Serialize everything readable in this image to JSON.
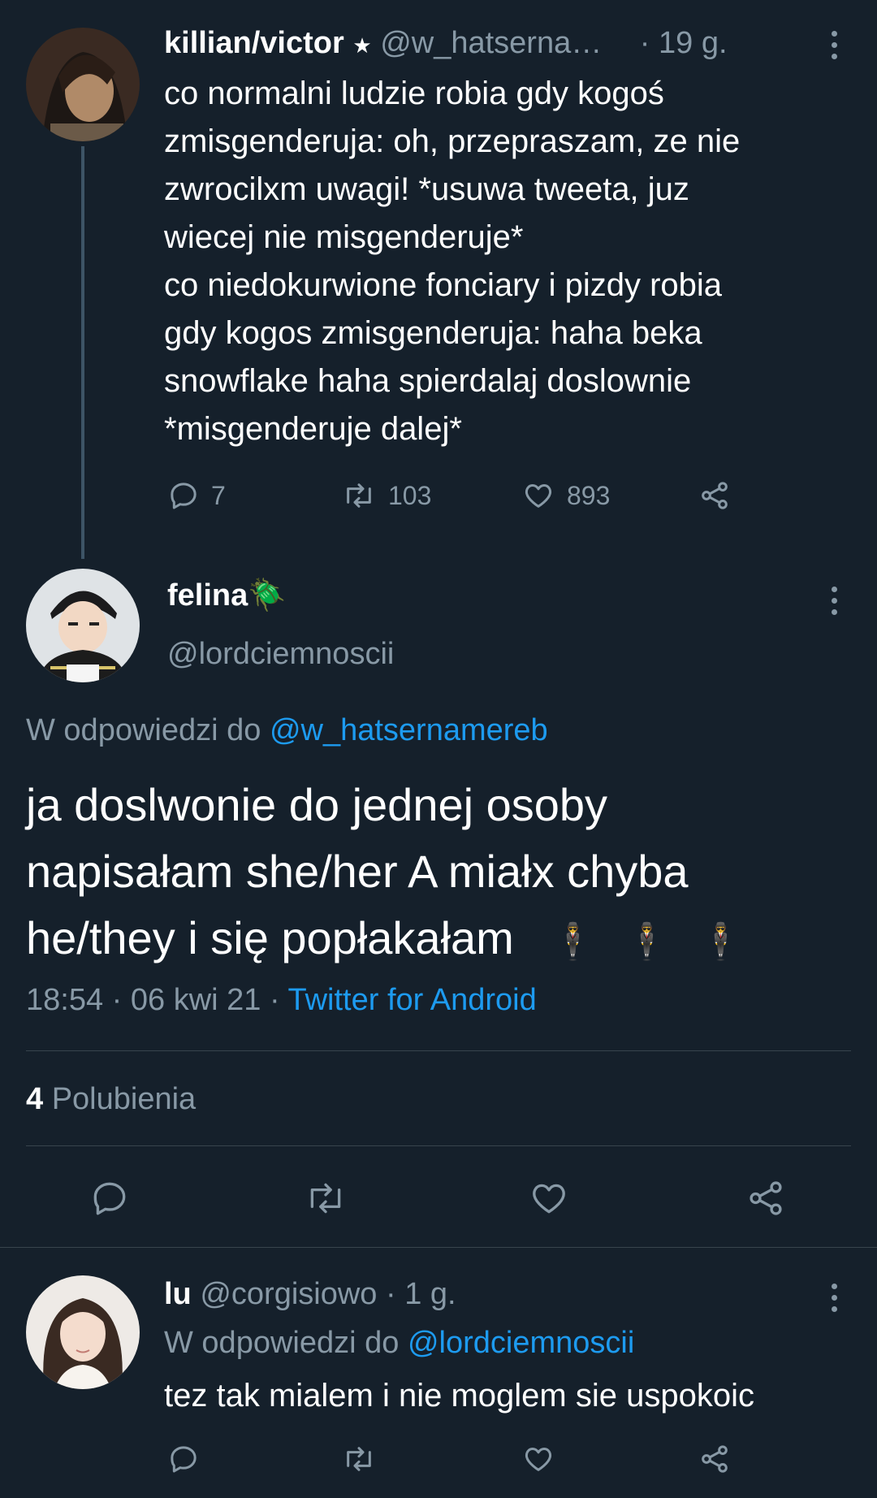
{
  "tweet1": {
    "display_name": "killian/victor",
    "name_symbol": "★",
    "handle": "@w_hatserna…",
    "time": "· 19 g.",
    "text": "co normalni ludzie robia gdy kogoś\nzmisgenderuja: oh, przepraszam, ze nie\nzwrocilxm uwagi! *usuwa tweeta, juz\nwiecej nie misgenderuje*\nco niedokurwione fonciary i pizdy robia\ngdy kogos zmisgenderuja: haha beka\nsnowflake haha spierdalaj doslownie\n*misgenderuje dalej*",
    "replies": "7",
    "retweets": "103",
    "likes": "893"
  },
  "main_tweet": {
    "display_name": "felina",
    "name_emoji": "🪲",
    "handle": "@lordciemnoscii",
    "reply_prefix": "W odpowiedzi do ",
    "reply_to": "@w_hatsernamereb",
    "text": "ja doslwonie do jednej osoby\nnapisałam she/her A miałx chyba\nhe/they i się popłakałam",
    "text_emoji": "🕴 🕴 🕴",
    "timestamp": "18:54 · 06 kwi 21 · ",
    "source": "Twitter for Android",
    "likes_count": "4",
    "likes_label": " Polubienia"
  },
  "reply_tweet": {
    "display_name": "lu",
    "handle": "@corgisiowo",
    "time": "· 1 g.",
    "reply_prefix": "W odpowiedzi do ",
    "reply_to": "@lordciemnoscii",
    "text": "tez tak mialem i nie moglem sie uspokoic"
  },
  "icons": [
    "reply-icon",
    "retweet-icon",
    "like-icon",
    "share-icon",
    "more-options-icon"
  ],
  "colors": {
    "background": "#15202b",
    "muted": "#8899a6",
    "link": "#1d9bf0",
    "divider": "#38444d"
  }
}
